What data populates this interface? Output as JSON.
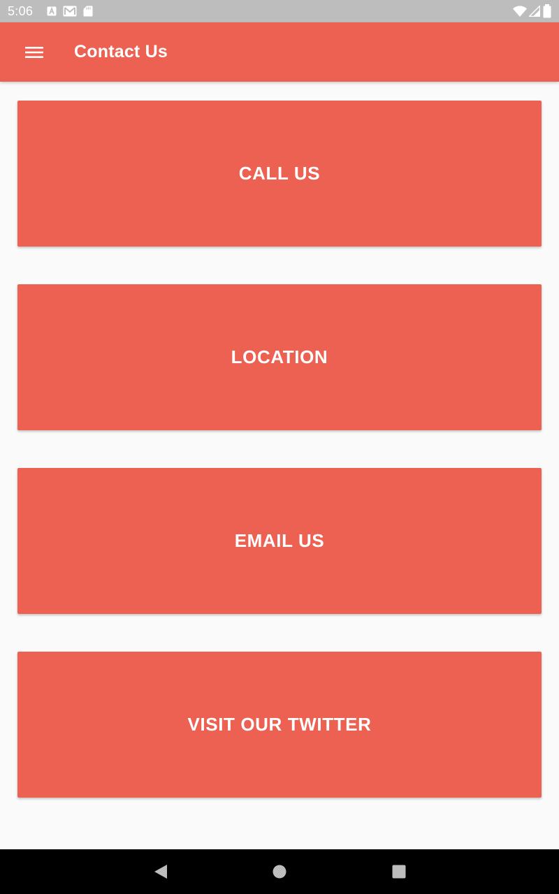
{
  "status_bar": {
    "time": "5:06",
    "icons": [
      "a-notification-icon",
      "gmail-icon",
      "sd-card-icon",
      "wifi-icon",
      "cell-signal-icon",
      "battery-icon"
    ]
  },
  "app_bar": {
    "title": "Contact Us",
    "menu_icon": "hamburger-menu-icon",
    "background": "#ec6152"
  },
  "buttons": [
    {
      "label": "CALL US"
    },
    {
      "label": "LOCATION"
    },
    {
      "label": "EMAIL US"
    },
    {
      "label": "VISIT OUR TWITTER"
    }
  ],
  "nav_bar": {
    "icons": [
      "back-icon",
      "home-icon",
      "recents-icon"
    ]
  },
  "colors": {
    "accent": "#ec6152",
    "page_background": "#fafafa",
    "status_bar": "#bdbdbd",
    "nav_bar": "#000000"
  }
}
